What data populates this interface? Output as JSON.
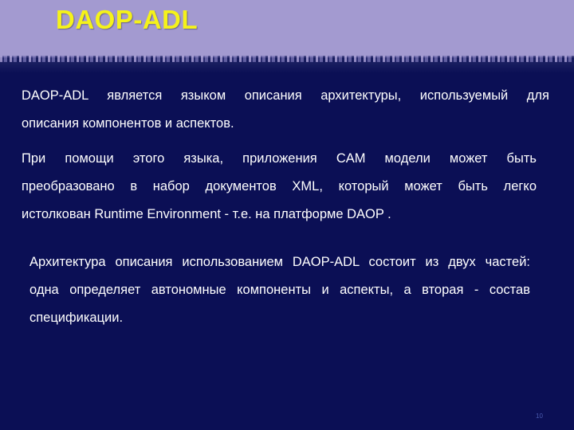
{
  "slide": {
    "title": "DAOP-ADL",
    "page_number": "10",
    "colors": {
      "header_background": "#a39ad0",
      "body_background": "#0b0f55",
      "title_color": "#f5f21a",
      "text_color": "#ffffff"
    },
    "paragraphs": [
      {
        "lines": [
          "DAOP-ADL является языком описания архитектуры, используемый для",
          "описания компонентов и аспектов."
        ]
      },
      {
        "lines": [
          "При помощи этого языка, приложения CAM модели может быть",
          "преобразовано в набор документов XML, который может быть легко",
          "истолкован Runtime Environment - т.е. на платформе DAOP ."
        ]
      },
      {
        "lines": [
          "Архитектура описания использованием DAOP-ADL состоит из двух частей:",
          "одна определяет автономные компоненты и аспекты, а вторая - состав",
          "спецификации."
        ]
      }
    ]
  }
}
